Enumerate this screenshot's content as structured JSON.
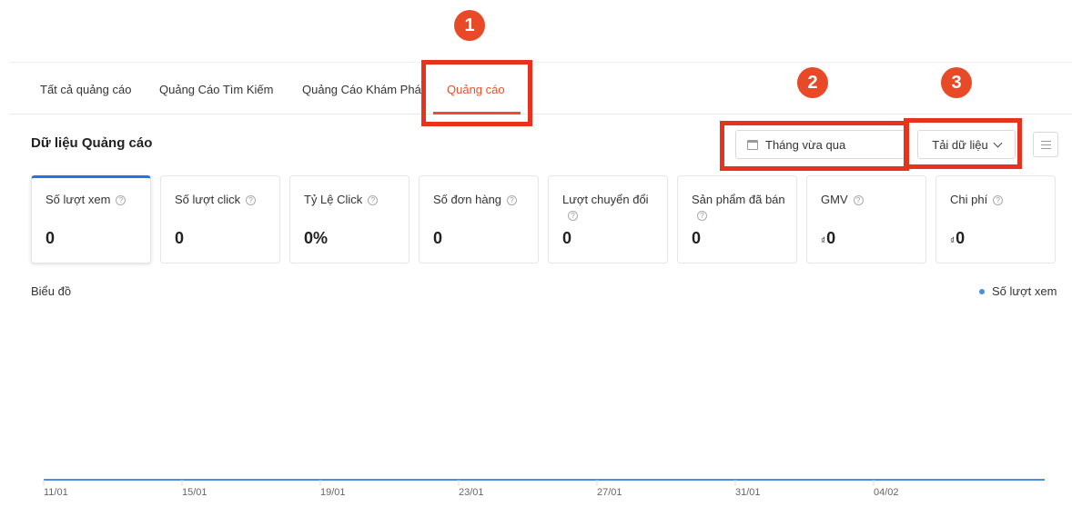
{
  "tabs": [
    {
      "label": "Tất cả quảng cáo",
      "active": false
    },
    {
      "label": "Quảng Cáo Tìm Kiếm",
      "active": false
    },
    {
      "label": "Quảng Cáo Khám Phá",
      "active": false
    },
    {
      "label": "Quảng cáo",
      "active": true
    }
  ],
  "section": {
    "title": "Dữ liệu Quảng cáo",
    "date_range": "Tháng vừa qua",
    "download_label": "Tải dữ liệu"
  },
  "metrics": [
    {
      "label": "Số lượt xem",
      "value": "0",
      "active": true
    },
    {
      "label": "Số lượt click",
      "value": "0"
    },
    {
      "label": "Tỷ Lệ Click",
      "value": "0%"
    },
    {
      "label": "Số đơn hàng",
      "value": "0"
    },
    {
      "label": "Lượt chuyển đổi",
      "value": "0"
    },
    {
      "label": "Sản phẩm đã bán",
      "value": "0"
    },
    {
      "label": "GMV",
      "value": "0",
      "currency": "₫"
    },
    {
      "label": "Chi phí",
      "value": "0",
      "currency": "₫"
    }
  ],
  "chart": {
    "title": "Biểu đồ",
    "legend": "Số lượt xem",
    "series_color": "#4a90e2"
  },
  "chart_data": {
    "type": "line",
    "x": [
      "11/01",
      "15/01",
      "19/01",
      "23/01",
      "27/01",
      "31/01",
      "04/02"
    ],
    "series": [
      {
        "name": "Số lượt xem",
        "values": [
          0,
          0,
          0,
          0,
          0,
          0,
          0
        ]
      }
    ]
  },
  "markers": [
    "1",
    "2",
    "3"
  ],
  "colors": {
    "accent": "#ee4d2d",
    "active_card": "#2673dd",
    "marker": "#e84a27"
  }
}
